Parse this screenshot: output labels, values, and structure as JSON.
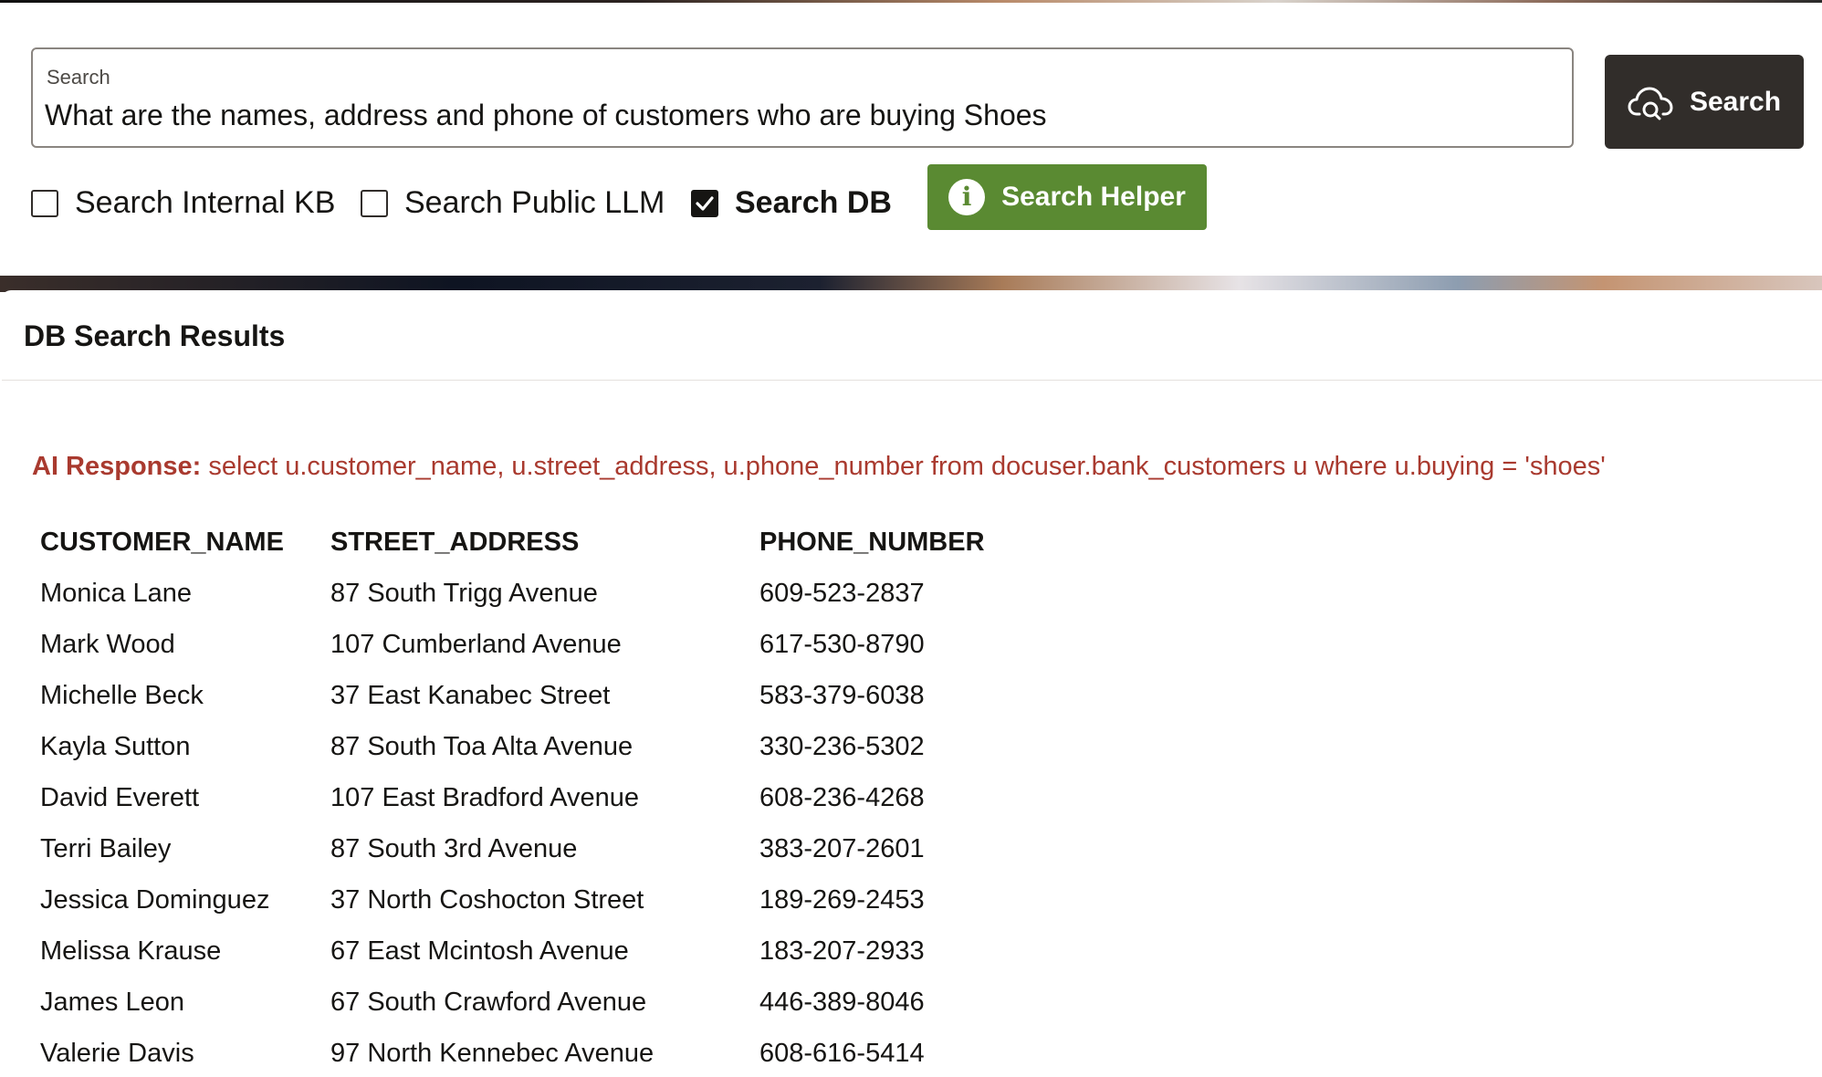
{
  "search": {
    "label": "Search",
    "value": "What are the names, address and phone of customers who are buying Shoes",
    "button_label": "Search"
  },
  "options": [
    {
      "label": "Search Internal KB",
      "checked": false
    },
    {
      "label": "Search Public LLM",
      "checked": false
    },
    {
      "label": "Search DB",
      "checked": true
    }
  ],
  "helper": {
    "label": "Search Helper"
  },
  "results": {
    "title": "DB Search Results",
    "ai_prefix": "AI Response:",
    "ai_query": "select u.customer_name, u.street_address, u.phone_number from docuser.bank_customers u where u.buying = 'shoes'",
    "columns": [
      "CUSTOMER_NAME",
      "STREET_ADDRESS",
      "PHONE_NUMBER"
    ],
    "rows": [
      [
        "Monica Lane",
        "87 South Trigg Avenue",
        "609-523-2837"
      ],
      [
        "Mark Wood",
        "107 Cumberland Avenue",
        "617-530-8790"
      ],
      [
        "Michelle Beck",
        "37 East Kanabec Street",
        "583-379-6038"
      ],
      [
        "Kayla Sutton",
        "87 South Toa Alta Avenue",
        "330-236-5302"
      ],
      [
        "David Everett",
        "107 East Bradford Avenue",
        "608-236-4268"
      ],
      [
        "Terri Bailey",
        "87 South 3rd Avenue",
        "383-207-2601"
      ],
      [
        "Jessica Dominguez",
        "37 North Coshocton Street",
        "189-269-2453"
      ],
      [
        "Melissa Krause",
        "67 East Mcintosh Avenue",
        "183-207-2933"
      ],
      [
        "James Leon",
        "67 South Crawford Avenue",
        "446-389-8046"
      ],
      [
        "Valerie Davis",
        "97 North Kennebec Avenue",
        "608-616-5414"
      ]
    ]
  },
  "colors": {
    "primary_button": "#312d2a",
    "helper_button": "#5a8a32",
    "ai_response": "#a93a2f"
  },
  "icons": {
    "search_button": "cloud-search-icon",
    "helper_button": "info-icon",
    "checkbox_checked": "checkmark-icon"
  }
}
